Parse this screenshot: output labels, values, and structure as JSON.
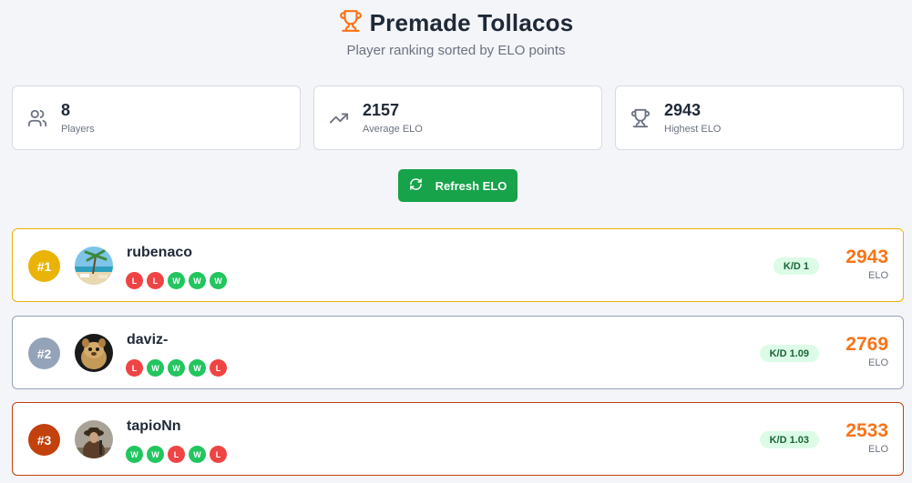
{
  "header": {
    "title": "Premade Tollacos",
    "subtitle": "Player ranking sorted by ELO points",
    "icon": "trophy-icon"
  },
  "stats": [
    {
      "value": "8",
      "label": "Players",
      "icon": "users-icon"
    },
    {
      "value": "2157",
      "label": "Average ELO",
      "icon": "trending-up-icon"
    },
    {
      "value": "2943",
      "label": "Highest ELO",
      "icon": "trophy-icon"
    }
  ],
  "refresh": {
    "label": "Refresh ELO",
    "icon": "refresh-icon"
  },
  "players": [
    {
      "rank": "#1",
      "name": "rubenaco",
      "results": [
        "L",
        "L",
        "W",
        "W",
        "W"
      ],
      "kd": "K/D 1",
      "elo": "2943",
      "elo_label": "ELO",
      "rank_color": "#eab308",
      "border_color": "#eab308"
    },
    {
      "rank": "#2",
      "name": "daviz-",
      "results": [
        "L",
        "W",
        "W",
        "W",
        "L"
      ],
      "kd": "K/D 1.09",
      "elo": "2769",
      "elo_label": "ELO",
      "rank_color": "#94a3b8",
      "border_color": "#94a3b8"
    },
    {
      "rank": "#3",
      "name": "tapioNn",
      "results": [
        "W",
        "W",
        "L",
        "W",
        "L"
      ],
      "kd": "K/D 1.03",
      "elo": "2533",
      "elo_label": "ELO",
      "rank_color": "#c2410c",
      "border_color": "#c2410c"
    }
  ],
  "colors": {
    "accent": "#f97316",
    "win": "#22c55e",
    "loss": "#ef4444",
    "refresh_button": "#16a34a",
    "kd_badge_bg": "#dcfce7"
  }
}
